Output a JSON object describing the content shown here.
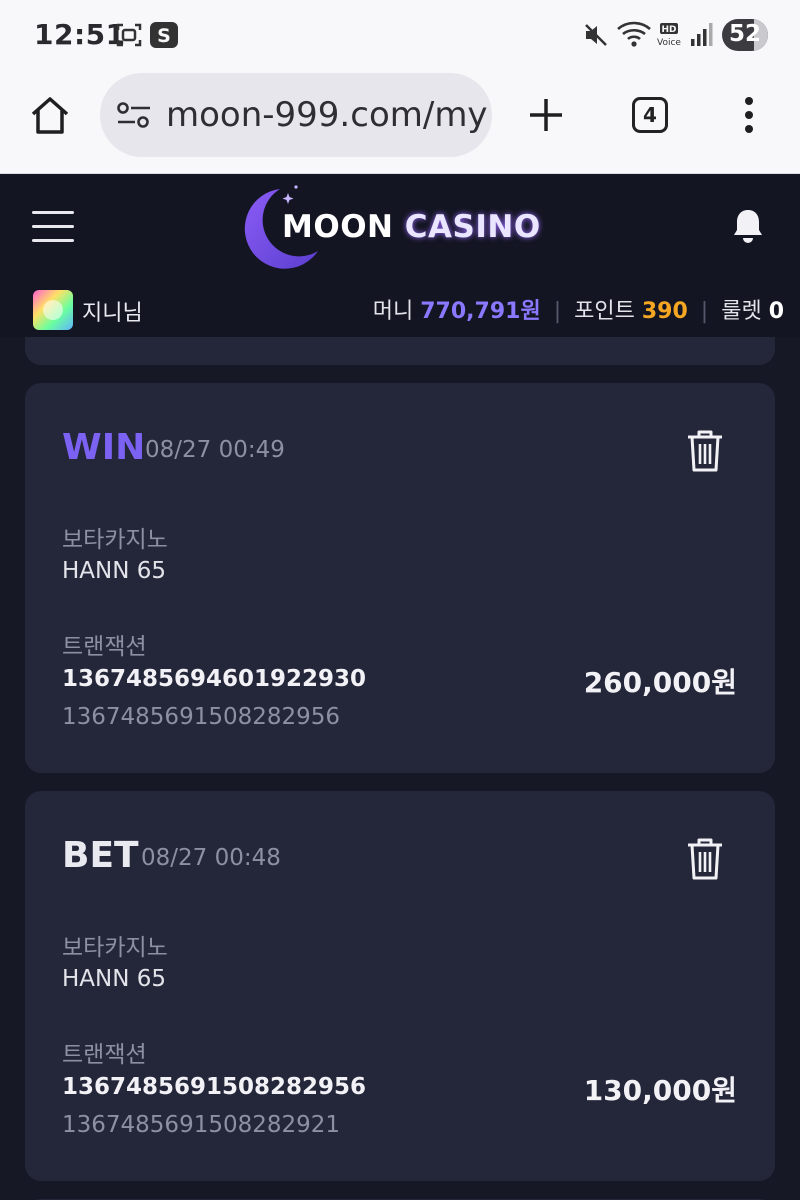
{
  "status_bar": {
    "time": "12:51",
    "battery": "52",
    "icons": [
      "screenshot-icon",
      "s-app-icon",
      "mute-icon",
      "wifi-icon",
      "hd-voice-icon",
      "signal-icon"
    ]
  },
  "browser": {
    "url": "moon-999.com/my",
    "tab_count": "4"
  },
  "header": {
    "logo_moon": "MOON",
    "logo_casino": "CASINO"
  },
  "user": {
    "name": "지니님",
    "money_label": "머니",
    "money_value": "770,791원",
    "points_label": "포인트",
    "points_value": "390",
    "roulette_label": "룰렛",
    "roulette_value": "0"
  },
  "records": [
    {
      "type": "WIN",
      "date": "08/27 00:49",
      "provider": "보타카지노",
      "game": "HANN 65",
      "tx_label": "트랜잭션",
      "tx_id": "1367485694601922930",
      "tx_ref": "1367485691508282956",
      "amount": "260,000원"
    },
    {
      "type": "BET",
      "date": "08/27 00:48",
      "provider": "보타카지노",
      "game": "HANN 65",
      "tx_label": "트랜잭션",
      "tx_id": "1367485691508282956",
      "tx_ref": "1367485691508282921",
      "amount": "130,000원"
    }
  ],
  "colors": {
    "accent_purple": "#7c62f2",
    "points_orange": "#f5a623",
    "card_bg": "#24263a",
    "page_bg": "#161826"
  }
}
